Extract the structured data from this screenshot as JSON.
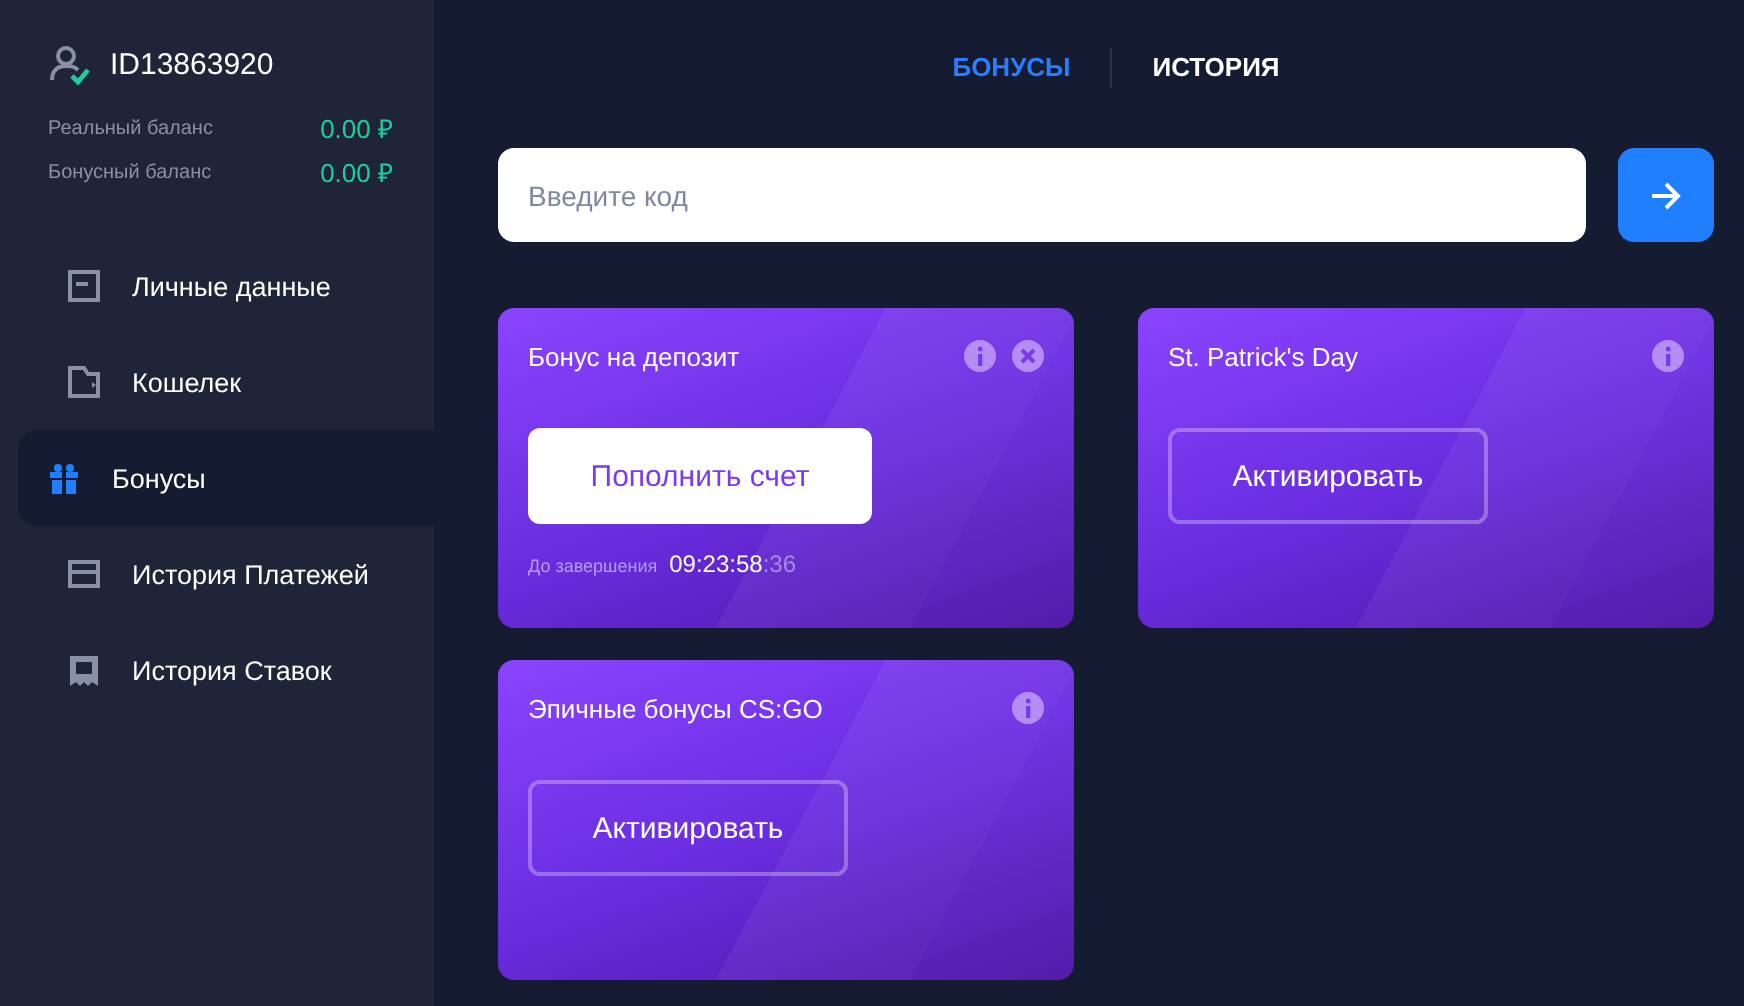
{
  "account": {
    "id": "ID13863920",
    "verified": true,
    "balances": [
      {
        "label": "Реальный баланс",
        "value": "0.00 ₽"
      },
      {
        "label": "Бонусный баланс",
        "value": "0.00 ₽"
      }
    ]
  },
  "sidebar": {
    "items": [
      {
        "label": "Личные данные",
        "selected": false
      },
      {
        "label": "Кошелек",
        "selected": false
      },
      {
        "label": "Бонусы",
        "selected": true
      },
      {
        "label": "История Платежей",
        "selected": false
      },
      {
        "label": "История Ставок",
        "selected": false
      }
    ]
  },
  "tabs": [
    {
      "label": "БОНУСЫ",
      "selected": true
    },
    {
      "label": "ИСТОРИЯ",
      "selected": false
    }
  ],
  "code_field": {
    "placeholder": "Введите код"
  },
  "bonuses": [
    {
      "title": "Бонус на депозит",
      "closable": true,
      "button": {
        "kind": "primary",
        "label": "Пополнить счет"
      },
      "timer": {
        "label": "До завершения",
        "time": "09:23:58",
        "seconds": ":36"
      }
    },
    {
      "title": "St. Patrick's Day",
      "closable": false,
      "button": {
        "kind": "outline",
        "label": "Активировать"
      }
    },
    {
      "title": "Эпичные бонусы CS:GO",
      "closable": false,
      "button": {
        "kind": "outline",
        "label": "Активировать"
      }
    }
  ]
}
